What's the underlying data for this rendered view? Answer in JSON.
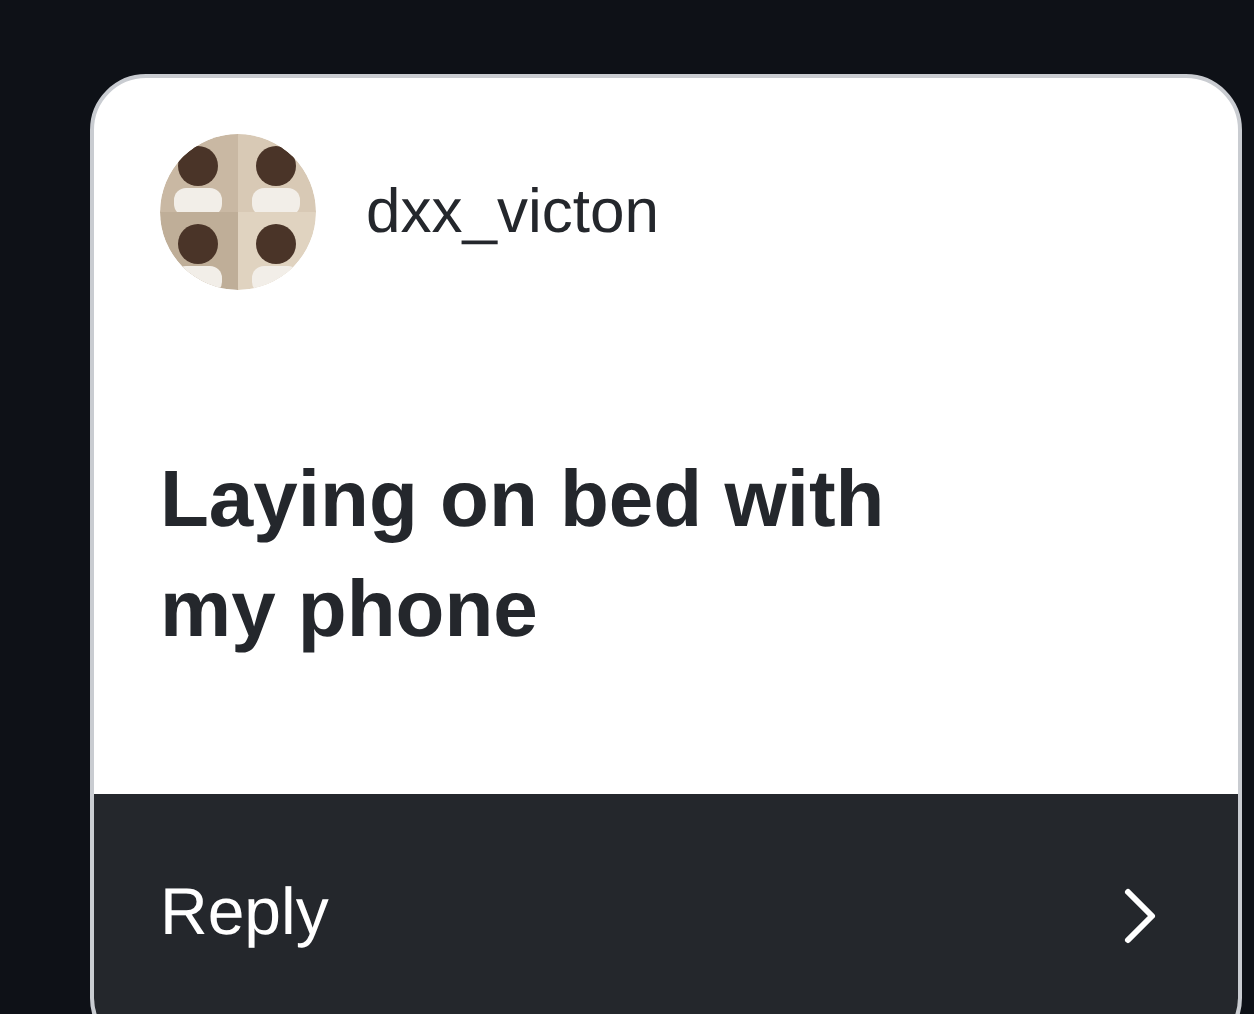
{
  "post": {
    "username": "dxx_victon",
    "text": "Laying on bed with my phone"
  },
  "reply_bar": {
    "label": "Reply"
  }
}
